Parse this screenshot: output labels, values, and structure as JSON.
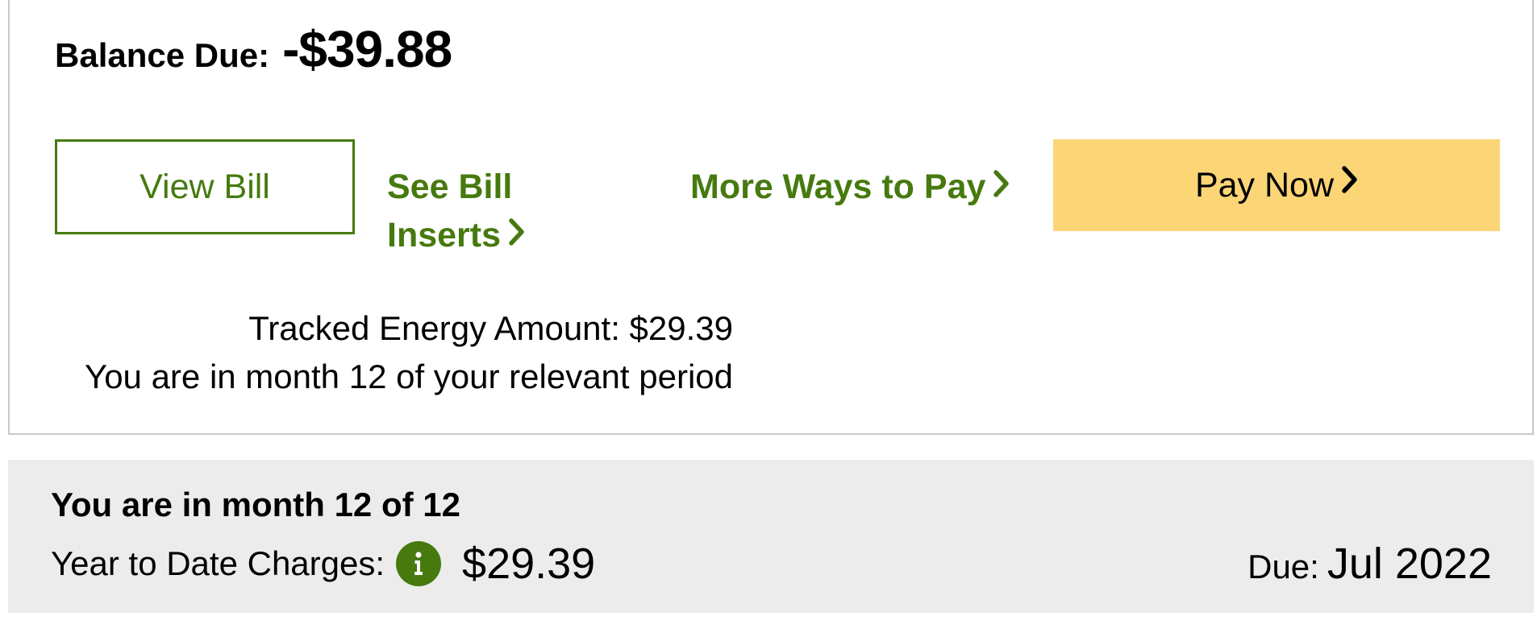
{
  "balance": {
    "label": "Balance Due:",
    "amount": "-$39.88"
  },
  "actions": {
    "view_bill": "View Bill",
    "see_bill_inserts_line1": "See Bill",
    "see_bill_inserts_line2": "Inserts",
    "more_ways_to_pay": "More Ways to Pay",
    "pay_now": "Pay Now"
  },
  "tracking": {
    "tracked_energy": "Tracked Energy Amount: $29.39",
    "relevant_period": "You are in month 12 of your relevant period"
  },
  "summary": {
    "title": "You are in month 12 of 12",
    "ytd_label": "Year to Date Charges:",
    "ytd_value": "$29.39",
    "due_label": "Due:",
    "due_value": "Jul 2022"
  },
  "icons": {
    "chevron": "chevron-right-icon",
    "info": "info-icon"
  },
  "colors": {
    "brand_green": "#467a0f",
    "pay_button": "#fcd576",
    "panel_gray": "#ececec",
    "card_border": "#c8c8c8"
  }
}
